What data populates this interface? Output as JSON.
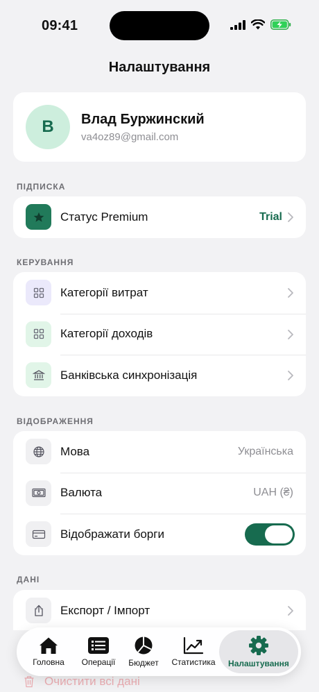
{
  "status_bar": {
    "time": "09:41"
  },
  "header": {
    "title": "Налаштування"
  },
  "profile": {
    "initial": "В",
    "name": "Влад Буржинский",
    "email": "va4oz89@gmail.com"
  },
  "sections": {
    "subscription": {
      "label": "ПІДПИСКА",
      "premium": {
        "label": "Статус Premium",
        "value": "Trial",
        "icon": "star-icon"
      }
    },
    "management": {
      "label": "КЕРУВАННЯ",
      "items": [
        {
          "label": "Категорії витрат",
          "icon": "grid-icon"
        },
        {
          "label": "Категорії доходів",
          "icon": "grid-icon"
        },
        {
          "label": "Банківська синхронізація",
          "icon": "bank-icon"
        }
      ]
    },
    "display": {
      "label": "ВІДОБРАЖЕННЯ",
      "language": {
        "label": "Мова",
        "value": "Українська",
        "icon": "globe-icon"
      },
      "currency": {
        "label": "Валюта",
        "value": "UAH (₴)",
        "icon": "banknote-icon"
      },
      "debts": {
        "label": "Відображати борги",
        "enabled": true,
        "icon": "card-icon"
      }
    },
    "data": {
      "label": "ДАНІ",
      "export": {
        "label": "Експорт / Імпорт",
        "icon": "share-icon"
      },
      "clear": {
        "label": "Очистити всі дані",
        "icon": "trash-icon"
      }
    }
  },
  "tab_bar": {
    "tabs": [
      {
        "label": "Головна",
        "icon": "home-icon"
      },
      {
        "label": "Операції",
        "icon": "list-icon"
      },
      {
        "label": "Бюджет",
        "icon": "pie-chart-icon"
      },
      {
        "label": "Статистика",
        "icon": "trend-chart-icon"
      },
      {
        "label": "Налаштування",
        "icon": "gear-icon",
        "active": true
      }
    ]
  },
  "colors": {
    "accent": "#176b4f",
    "background": "#f2f2f4",
    "expense_icon_bg": "#ebe9fb",
    "income_icon_bg": "#e1f5e8",
    "bank_icon_bg": "#e1f5e8",
    "neutral_icon_bg": "#f0f0f2"
  }
}
